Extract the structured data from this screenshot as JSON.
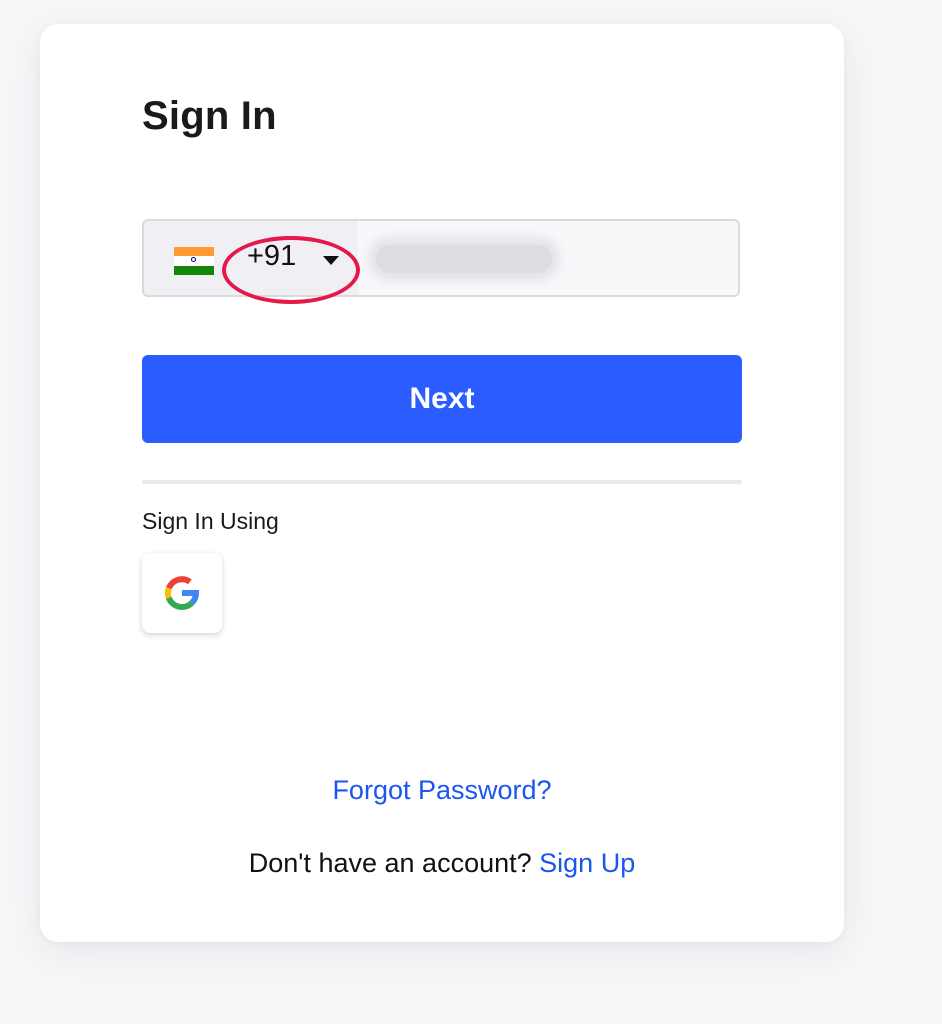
{
  "form": {
    "title": "Sign In",
    "country_code": "+91",
    "country_flag": "india-flag-icon",
    "phone_value": "",
    "next_label": "Next",
    "social_heading": "Sign In Using",
    "social_provider": "google-icon",
    "forgot_password_label": "Forgot Password?",
    "no_account_text": "Don't have an account?",
    "sign_up_label": "Sign Up"
  },
  "colors": {
    "primary": "#2b5cff",
    "link": "#1a56f0",
    "highlight_ring": "#e6174a",
    "flag_saffron": "#ff9933",
    "flag_green": "#138808"
  }
}
